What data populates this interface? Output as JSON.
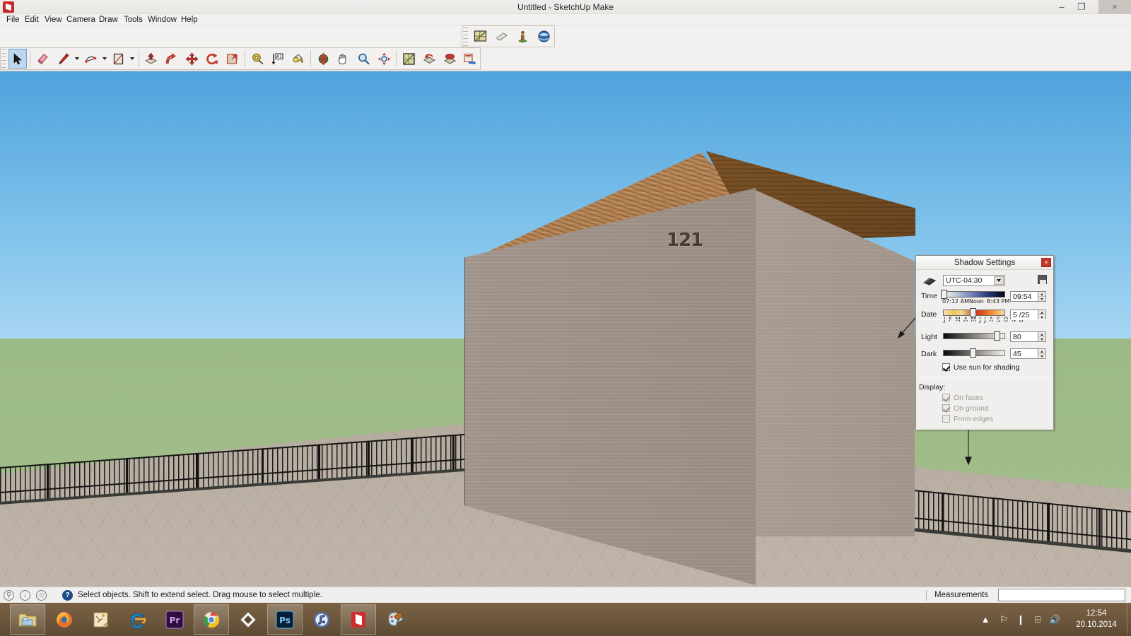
{
  "window": {
    "title": "Untitled - SketchUp Make",
    "app_icon": "sketchup-icon",
    "minimize": "–",
    "maximize": "❐",
    "close": "×"
  },
  "menubar": {
    "items": [
      {
        "label": "File",
        "name": "menu-file"
      },
      {
        "label": "Edit",
        "name": "menu-edit"
      },
      {
        "label": "View",
        "name": "menu-view"
      },
      {
        "label": "Camera",
        "name": "menu-camera"
      },
      {
        "label": "Draw",
        "name": "menu-draw"
      },
      {
        "label": "Tools",
        "name": "menu-tools"
      },
      {
        "label": "Window",
        "name": "menu-window"
      },
      {
        "label": "Help",
        "name": "menu-help"
      }
    ]
  },
  "toolbars": {
    "top_small": [
      {
        "icon": "section-plane-icon",
        "name": "toolbar-section-plane"
      },
      {
        "icon": "section-display-icon",
        "name": "toolbar-section-display"
      },
      {
        "icon": "person-scale-icon",
        "name": "toolbar-person-scale"
      },
      {
        "icon": "globe-geolocation-icon",
        "name": "toolbar-geolocation"
      }
    ],
    "main": [
      {
        "icon": "select-arrow-icon",
        "name": "tool-select",
        "selected": true
      },
      {
        "icon": "eraser-icon",
        "name": "tool-eraser"
      },
      {
        "icon": "pencil-line-icon",
        "name": "tool-line",
        "caret": true
      },
      {
        "icon": "arc-icon",
        "name": "tool-arc",
        "caret": true
      },
      {
        "icon": "rectangle-icon",
        "name": "tool-rectangle",
        "caret": true
      },
      {
        "icon": "pushpull-icon",
        "name": "tool-pushpull"
      },
      {
        "icon": "followme-icon",
        "name": "tool-followme"
      },
      {
        "icon": "move-icon",
        "name": "tool-move"
      },
      {
        "icon": "rotate-icon",
        "name": "tool-rotate"
      },
      {
        "icon": "scale-icon",
        "name": "tool-scale"
      },
      {
        "icon": "tape-measure-icon",
        "name": "tool-tape-measure"
      },
      {
        "icon": "dimension-icon",
        "name": "tool-dimension"
      },
      {
        "icon": "paint-bucket-icon",
        "name": "tool-paint-bucket"
      },
      {
        "icon": "orbit-icon",
        "name": "tool-orbit"
      },
      {
        "icon": "pan-hand-icon",
        "name": "tool-pan"
      },
      {
        "icon": "zoom-magnifier-icon",
        "name": "tool-zoom"
      },
      {
        "icon": "zoom-extents-icon",
        "name": "tool-zoom-extents"
      },
      {
        "icon": "previous-view-icon",
        "name": "tool-previous-view"
      },
      {
        "icon": "iso-view-icon",
        "name": "tool-iso-view"
      },
      {
        "icon": "top-view-icon",
        "name": "tool-top-view"
      },
      {
        "icon": "next-view-icon",
        "name": "tool-next-view"
      }
    ]
  },
  "viewport": {
    "house_number": "121",
    "sky_top_color": "#4fa3dd",
    "sky_bottom_color": "#a7d6f2",
    "grass_color": "#9cba85",
    "patio_color": "#b9afa3",
    "wall_color": "#9e9188",
    "roof_light_color": "#b98554",
    "roof_dark_color": "#744d23",
    "fence_color": "#141414"
  },
  "shadow_dialog": {
    "title": "Shadow Settings",
    "close_label": "×",
    "timezone": "UTC-04:30",
    "time": {
      "label": "Time",
      "value": "09:54",
      "tick_start": "07:12 AM",
      "tick_mid": "Noon",
      "tick_end": "8:43 PM"
    },
    "date": {
      "label": "Date",
      "value": "5 /25",
      "months": "J F M A M J  J A S O N D"
    },
    "light": {
      "label": "Light",
      "value": "80"
    },
    "dark": {
      "label": "Dark",
      "value": "45"
    },
    "use_sun": {
      "label": "Use sun for shading",
      "checked": true
    },
    "display": {
      "label": "Display:",
      "options": [
        {
          "label": "On faces",
          "checked": true,
          "disabled": true
        },
        {
          "label": "On ground",
          "checked": true,
          "disabled": true
        },
        {
          "label": "From edges",
          "checked": false,
          "disabled": true
        }
      ]
    }
  },
  "statusbar": {
    "message": "Select objects. Shift to extend select. Drag mouse to select multiple.",
    "measurements_label": "Measurements",
    "measurements_value": "",
    "icons": [
      {
        "glyph": "⚲",
        "name": "status-info-icon"
      },
      {
        "glyph": "↓",
        "name": "status-download-icon"
      },
      {
        "glyph": "☺",
        "name": "status-account-icon"
      }
    ],
    "help_glyph": "?"
  },
  "taskbar": {
    "buttons": [
      {
        "name": "taskbar-file-explorer",
        "icon": "folder-icon",
        "active": true
      },
      {
        "name": "taskbar-firefox",
        "icon": "firefox-icon",
        "active": false
      },
      {
        "name": "taskbar-notes",
        "icon": "notes-icon",
        "active": false
      },
      {
        "name": "taskbar-ie",
        "icon": "internet-explorer-icon",
        "active": false
      },
      {
        "name": "taskbar-premiere",
        "icon": "premiere-pro-icon",
        "active": false
      },
      {
        "name": "taskbar-chrome",
        "icon": "chrome-icon",
        "active": true
      },
      {
        "name": "taskbar-diamond",
        "icon": "diamond-icon",
        "active": false
      },
      {
        "name": "taskbar-photoshop",
        "icon": "photoshop-icon",
        "active": true
      },
      {
        "name": "taskbar-itunes",
        "icon": "itunes-icon",
        "active": false
      },
      {
        "name": "taskbar-sketchup",
        "icon": "sketchup-icon",
        "active": true
      },
      {
        "name": "taskbar-paint",
        "icon": "paint-palette-icon",
        "active": false
      }
    ],
    "tray": [
      {
        "glyph": "▲",
        "name": "tray-show-hidden-icon"
      },
      {
        "glyph": "⚐",
        "name": "tray-action-center-icon"
      },
      {
        "glyph": "❙",
        "name": "tray-battery-icon"
      },
      {
        "glyph": "⌸",
        "name": "tray-network-icon"
      },
      {
        "glyph": "🔊",
        "name": "tray-volume-icon"
      }
    ],
    "clock_time": "12:54",
    "clock_date": "20.10.2014"
  }
}
